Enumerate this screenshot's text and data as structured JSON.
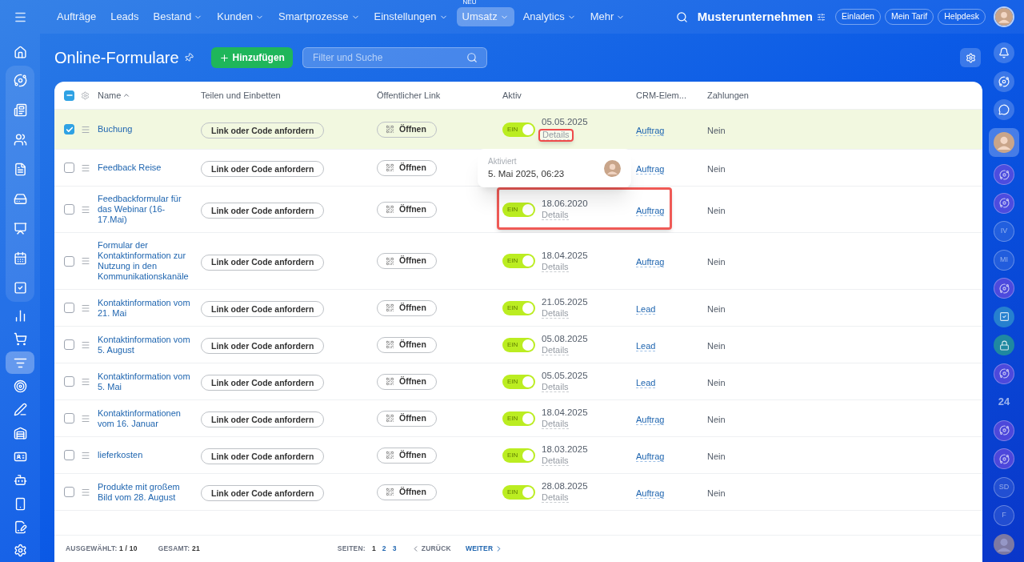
{
  "topnav": {
    "items": [
      {
        "label": "Aufträge",
        "dropdown": false,
        "selected": false
      },
      {
        "label": "Leads",
        "dropdown": false,
        "selected": false
      },
      {
        "label": "Bestand",
        "dropdown": true,
        "selected": false
      },
      {
        "label": "Kunden",
        "dropdown": true,
        "selected": false
      },
      {
        "label": "Smartprozesse",
        "dropdown": true,
        "selected": false
      },
      {
        "label": "Einstellungen",
        "dropdown": true,
        "selected": false
      },
      {
        "label": "Umsatz",
        "dropdown": true,
        "selected": true,
        "badge": "NEU"
      },
      {
        "label": "Analytics",
        "dropdown": true,
        "selected": false
      },
      {
        "label": "Mehr",
        "dropdown": true,
        "selected": false
      }
    ],
    "company": "Musterunternehmen",
    "buttons": [
      "Einladen",
      "Mein Tarif",
      "Helpdesk"
    ]
  },
  "left_sidebar": {
    "top": [
      {
        "kind": "home",
        "selected": false
      }
    ],
    "group": [
      {
        "kind": "flow",
        "selected": false
      },
      {
        "kind": "news",
        "selected": false
      },
      {
        "kind": "people",
        "selected": false
      },
      {
        "kind": "document",
        "selected": false
      },
      {
        "kind": "drive",
        "selected": false
      },
      {
        "kind": "presentation",
        "selected": false
      },
      {
        "kind": "calendar",
        "selected": false
      },
      {
        "kind": "tasks",
        "selected": false
      }
    ],
    "rest": [
      {
        "kind": "chart",
        "selected": false
      },
      {
        "kind": "cart",
        "selected": false
      },
      {
        "kind": "funnel",
        "selected": true
      },
      {
        "kind": "target",
        "selected": false
      },
      {
        "kind": "pen",
        "selected": false
      },
      {
        "kind": "warehouse",
        "selected": false
      },
      {
        "kind": "card",
        "selected": false
      },
      {
        "kind": "bot",
        "selected": false
      },
      {
        "kind": "device",
        "selected": false
      },
      {
        "kind": "sign",
        "selected": false
      },
      {
        "kind": "settings",
        "selected": false
      }
    ]
  },
  "page": {
    "title": "Online-Formulare",
    "add_button": "Hinzufügen",
    "search": {
      "placeholder": "Filter und Suche"
    }
  },
  "table": {
    "header_checked": true,
    "columns": [
      "Name",
      "Teilen und Einbetten",
      "Öffentlicher Link",
      "Aktiv",
      "CRM-Elem...",
      "Zahlungen"
    ],
    "rows": [
      {
        "name": "Buchung",
        "checked": true,
        "share": "Link oder Code anfordern",
        "open": "Öffnen",
        "on": true,
        "toggle": "EIN",
        "date": "05.05.2025",
        "details": "Details",
        "crm": "Auftrag",
        "payments": "Nein",
        "details_highlighted": true,
        "tooltip": {
          "label": "Aktiviert",
          "value": "5. Mai 2025, 06:23"
        }
      },
      {
        "name": "Feedback Reise",
        "checked": false,
        "share": "Link oder Code anfordern",
        "open": "Öffnen",
        "crm": "Auftrag",
        "payments": "Nein"
      },
      {
        "name": "Feedbackformular für das Webinar (16-17.Mai)",
        "checked": false,
        "share": "Link oder Code anfordern",
        "open": "Öffnen",
        "on": true,
        "toggle": "EIN",
        "date": "18.06.2020",
        "details": "Details",
        "crm": "Auftrag",
        "payments": "Nein",
        "status_highlighted": true
      },
      {
        "name": "Formular der Kontaktinformation zur Nutzung in den Kommunikationskanäle",
        "checked": false,
        "share": "Link oder Code anfordern",
        "open": "Öffnen",
        "on": true,
        "toggle": "EIN",
        "date": "18.04.2025",
        "details": "Details",
        "crm": "Auftrag",
        "payments": "Nein"
      },
      {
        "name": "Kontaktinformation vom 21. Mai",
        "checked": false,
        "share": "Link oder Code anfordern",
        "open": "Öffnen",
        "on": true,
        "toggle": "EIN",
        "date": "21.05.2025",
        "details": "Details",
        "crm": "Lead",
        "payments": "Nein"
      },
      {
        "name": "Kontaktinformation vom 5. August",
        "checked": false,
        "share": "Link oder Code anfordern",
        "open": "Öffnen",
        "on": true,
        "toggle": "EIN",
        "date": "05.08.2025",
        "details": "Details",
        "crm": "Lead",
        "payments": "Nein"
      },
      {
        "name": "Kontaktinformation vom 5. Mai",
        "checked": false,
        "share": "Link oder Code anfordern",
        "open": "Öffnen",
        "on": true,
        "toggle": "EIN",
        "date": "05.05.2025",
        "details": "Details",
        "crm": "Lead",
        "payments": "Nein"
      },
      {
        "name": "Kontaktinformationen vom 16. Januar",
        "checked": false,
        "share": "Link oder Code anfordern",
        "open": "Öffnen",
        "on": true,
        "toggle": "EIN",
        "date": "18.04.2025",
        "details": "Details",
        "crm": "Auftrag",
        "payments": "Nein"
      },
      {
        "name": "lieferkosten",
        "checked": false,
        "share": "Link oder Code anfordern",
        "open": "Öffnen",
        "on": true,
        "toggle": "EIN",
        "date": "18.03.2025",
        "details": "Details",
        "crm": "Auftrag",
        "payments": "Nein"
      },
      {
        "name": "Produkte mit großem Bild vom 28. August",
        "checked": false,
        "share": "Link oder Code anfordern",
        "open": "Öffnen",
        "on": true,
        "toggle": "EIN",
        "date": "28.08.2025",
        "details": "Details",
        "crm": "Auftrag",
        "payments": "Nein"
      }
    ]
  },
  "footer": {
    "selected_label": "AUSGEWÄHLT:",
    "selected_value": "1 / 10",
    "total_label": "GESAMT:",
    "total_value": "21",
    "pages_label": "SEITEN:",
    "pages": [
      {
        "label": "1",
        "selected": true
      },
      {
        "label": "2",
        "selected": false
      },
      {
        "label": "3",
        "selected": false
      }
    ],
    "prev": "ZURÜCK",
    "next": "WEITER"
  },
  "right_sidebar": [
    {
      "kind": "bell"
    },
    {
      "kind": "copilot"
    },
    {
      "kind": "chat"
    },
    {
      "kind": "avatar",
      "selected": true
    },
    {
      "kind": "channel"
    },
    {
      "kind": "channel"
    },
    {
      "kind": "initials",
      "text": "IV"
    },
    {
      "kind": "initials",
      "text": "MI"
    },
    {
      "kind": "channel"
    },
    {
      "kind": "tasks"
    },
    {
      "kind": "lock"
    },
    {
      "kind": "channel"
    },
    {
      "kind": "brand",
      "text": "24"
    },
    {
      "kind": "channel"
    },
    {
      "kind": "channel"
    },
    {
      "kind": "initials",
      "text": "SD"
    },
    {
      "kind": "initials",
      "text": "F"
    },
    {
      "kind": "avatar",
      "selected": false
    }
  ]
}
